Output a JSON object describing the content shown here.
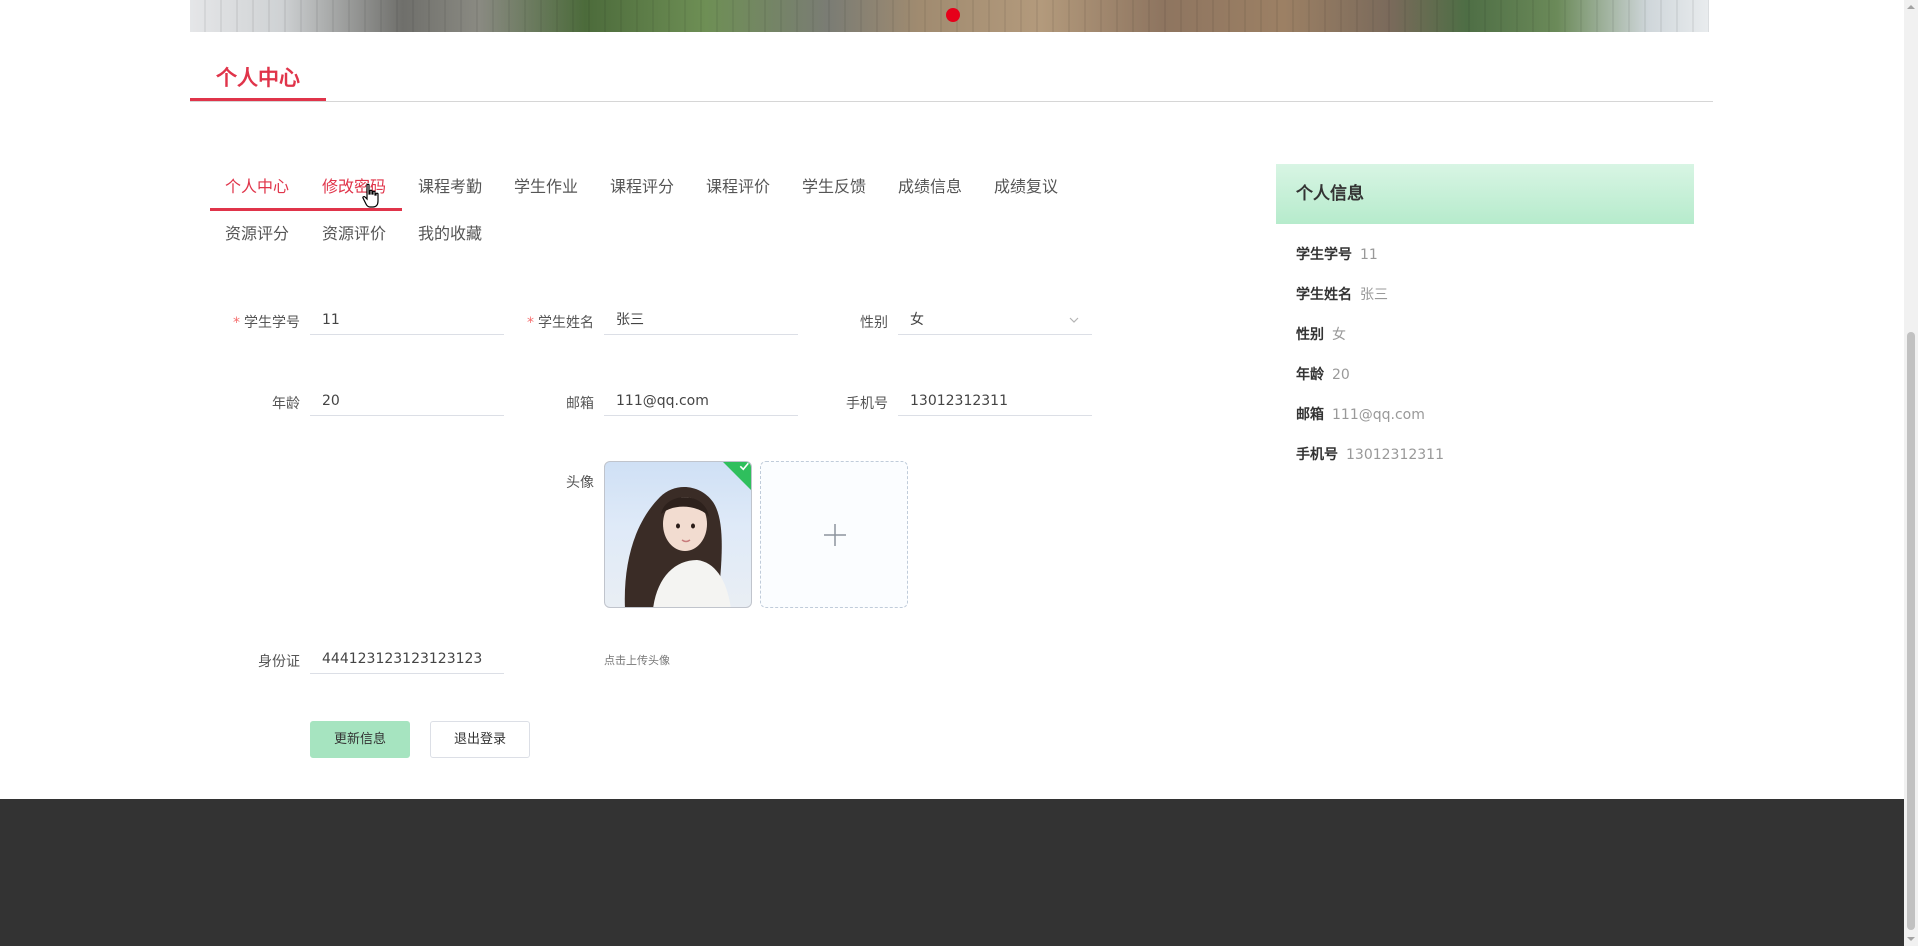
{
  "section_title": "个人中心",
  "tabs": [
    {
      "label": "个人中心"
    },
    {
      "label": "修改密码"
    },
    {
      "label": "课程考勤"
    },
    {
      "label": "学生作业"
    },
    {
      "label": "课程评分"
    },
    {
      "label": "课程评价"
    },
    {
      "label": "学生反馈"
    },
    {
      "label": "成绩信息"
    },
    {
      "label": "成绩复议"
    },
    {
      "label": "资源评分"
    },
    {
      "label": "资源评价"
    },
    {
      "label": "我的收藏"
    }
  ],
  "form": {
    "required_mark": "*",
    "student_no": {
      "label": "学生学号",
      "value": "11"
    },
    "student_name": {
      "label": "学生姓名",
      "value": "张三"
    },
    "gender": {
      "label": "性别",
      "value": "女"
    },
    "age": {
      "label": "年龄",
      "value": "20"
    },
    "email": {
      "label": "邮箱",
      "value": "111@qq.com"
    },
    "phone": {
      "label": "手机号",
      "value": "13012312311"
    },
    "avatar": {
      "label": "头像",
      "tip": "点击上传头像"
    },
    "id_card": {
      "label": "身份证",
      "value": "444123123123123123"
    },
    "update_button": "更新信息",
    "logout_button": "退出登录"
  },
  "profile_card": {
    "title": "个人信息",
    "rows": [
      {
        "key": "学生学号",
        "value": "11"
      },
      {
        "key": "学生姓名",
        "value": "张三"
      },
      {
        "key": "性别",
        "value": "女"
      },
      {
        "key": "年龄",
        "value": "20"
      },
      {
        "key": "邮箱",
        "value": "111@qq.com"
      },
      {
        "key": "手机号",
        "value": "13012312311"
      }
    ]
  },
  "colors": {
    "accent": "#e0344a",
    "button_primary": "#a6e4c0",
    "card_header": "#c6f0d8",
    "footer": "#333333",
    "carousel_dot": "#e6001a"
  }
}
